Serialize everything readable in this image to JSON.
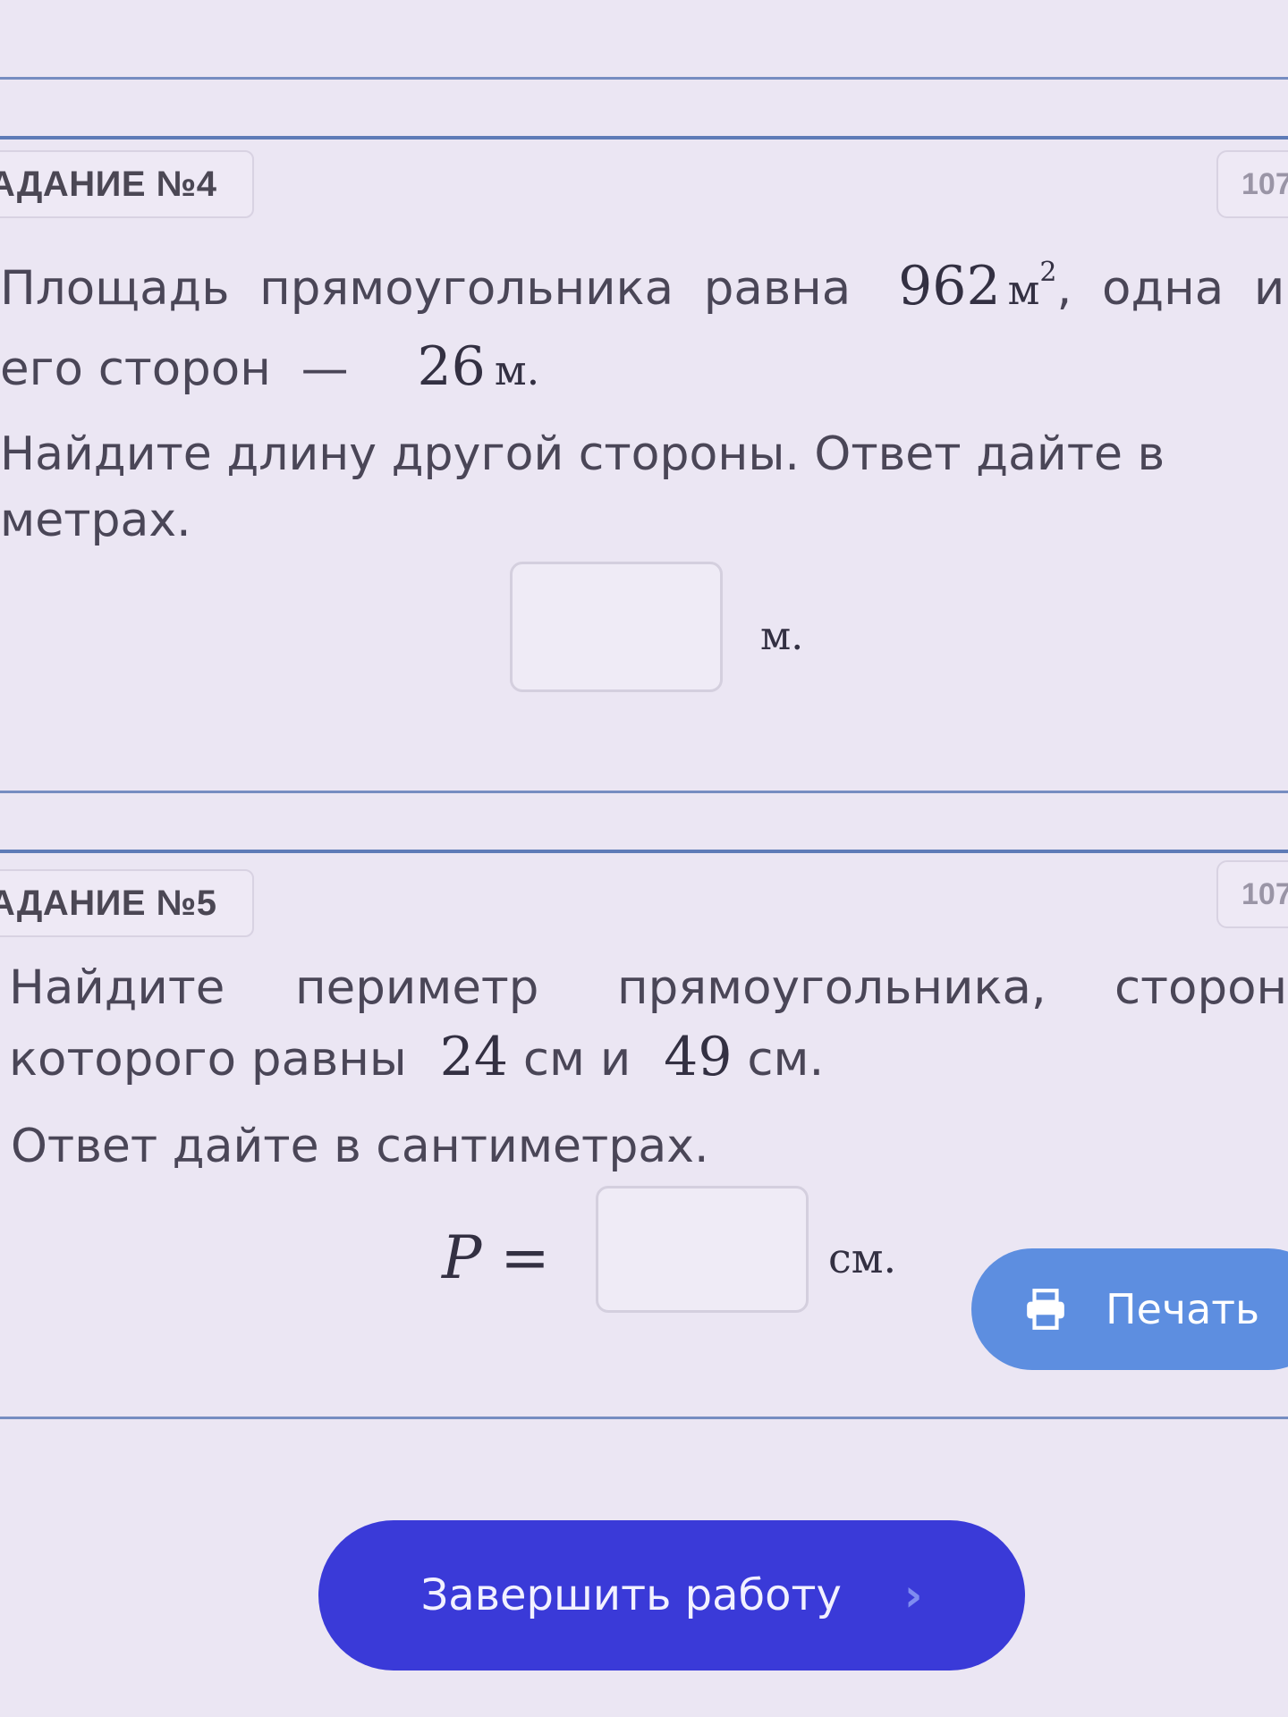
{
  "task4": {
    "badge": "АДАНИЕ №4",
    "id": "107",
    "line1_text": "Площадь  прямоугольника  равна",
    "line1_area_value": "962",
    "line1_area_unit": "м",
    "line1_area_exp": "2",
    "line1_tail": ",  одна  и",
    "line2_text": "его сторон  —",
    "line2_value": "26",
    "line2_unit": "м.",
    "question_line1": "Найдите длину другой стороны. Ответ дайте в",
    "question_line2": "метрах.",
    "answer_unit": "м."
  },
  "task5": {
    "badge": "АДАНИЕ №5",
    "id": "107",
    "line1_w1": "Найдите",
    "line1_w2": "периметр",
    "line1_w3": "прямоугольника,",
    "line1_w4": "сторон",
    "line2_text": "которого равны",
    "line2_value1": "24",
    "line2_mid": "см и",
    "line2_value2": "49",
    "line2_unit": "см.",
    "question": "Ответ дайте в сантиметрах.",
    "formula_label": "P =",
    "answer_unit": "см."
  },
  "buttons": {
    "print_label": "Печать",
    "finish_label": "Завершить работу",
    "finish_chevron": "›"
  },
  "colors": {
    "background": "#ebe6f3",
    "rule": "#4f6fb0",
    "print_button": "#5d8ee0",
    "finish_button": "#3a3ad8"
  },
  "icons": {
    "print": "printer-icon",
    "finish": "chevron-right-icon"
  }
}
